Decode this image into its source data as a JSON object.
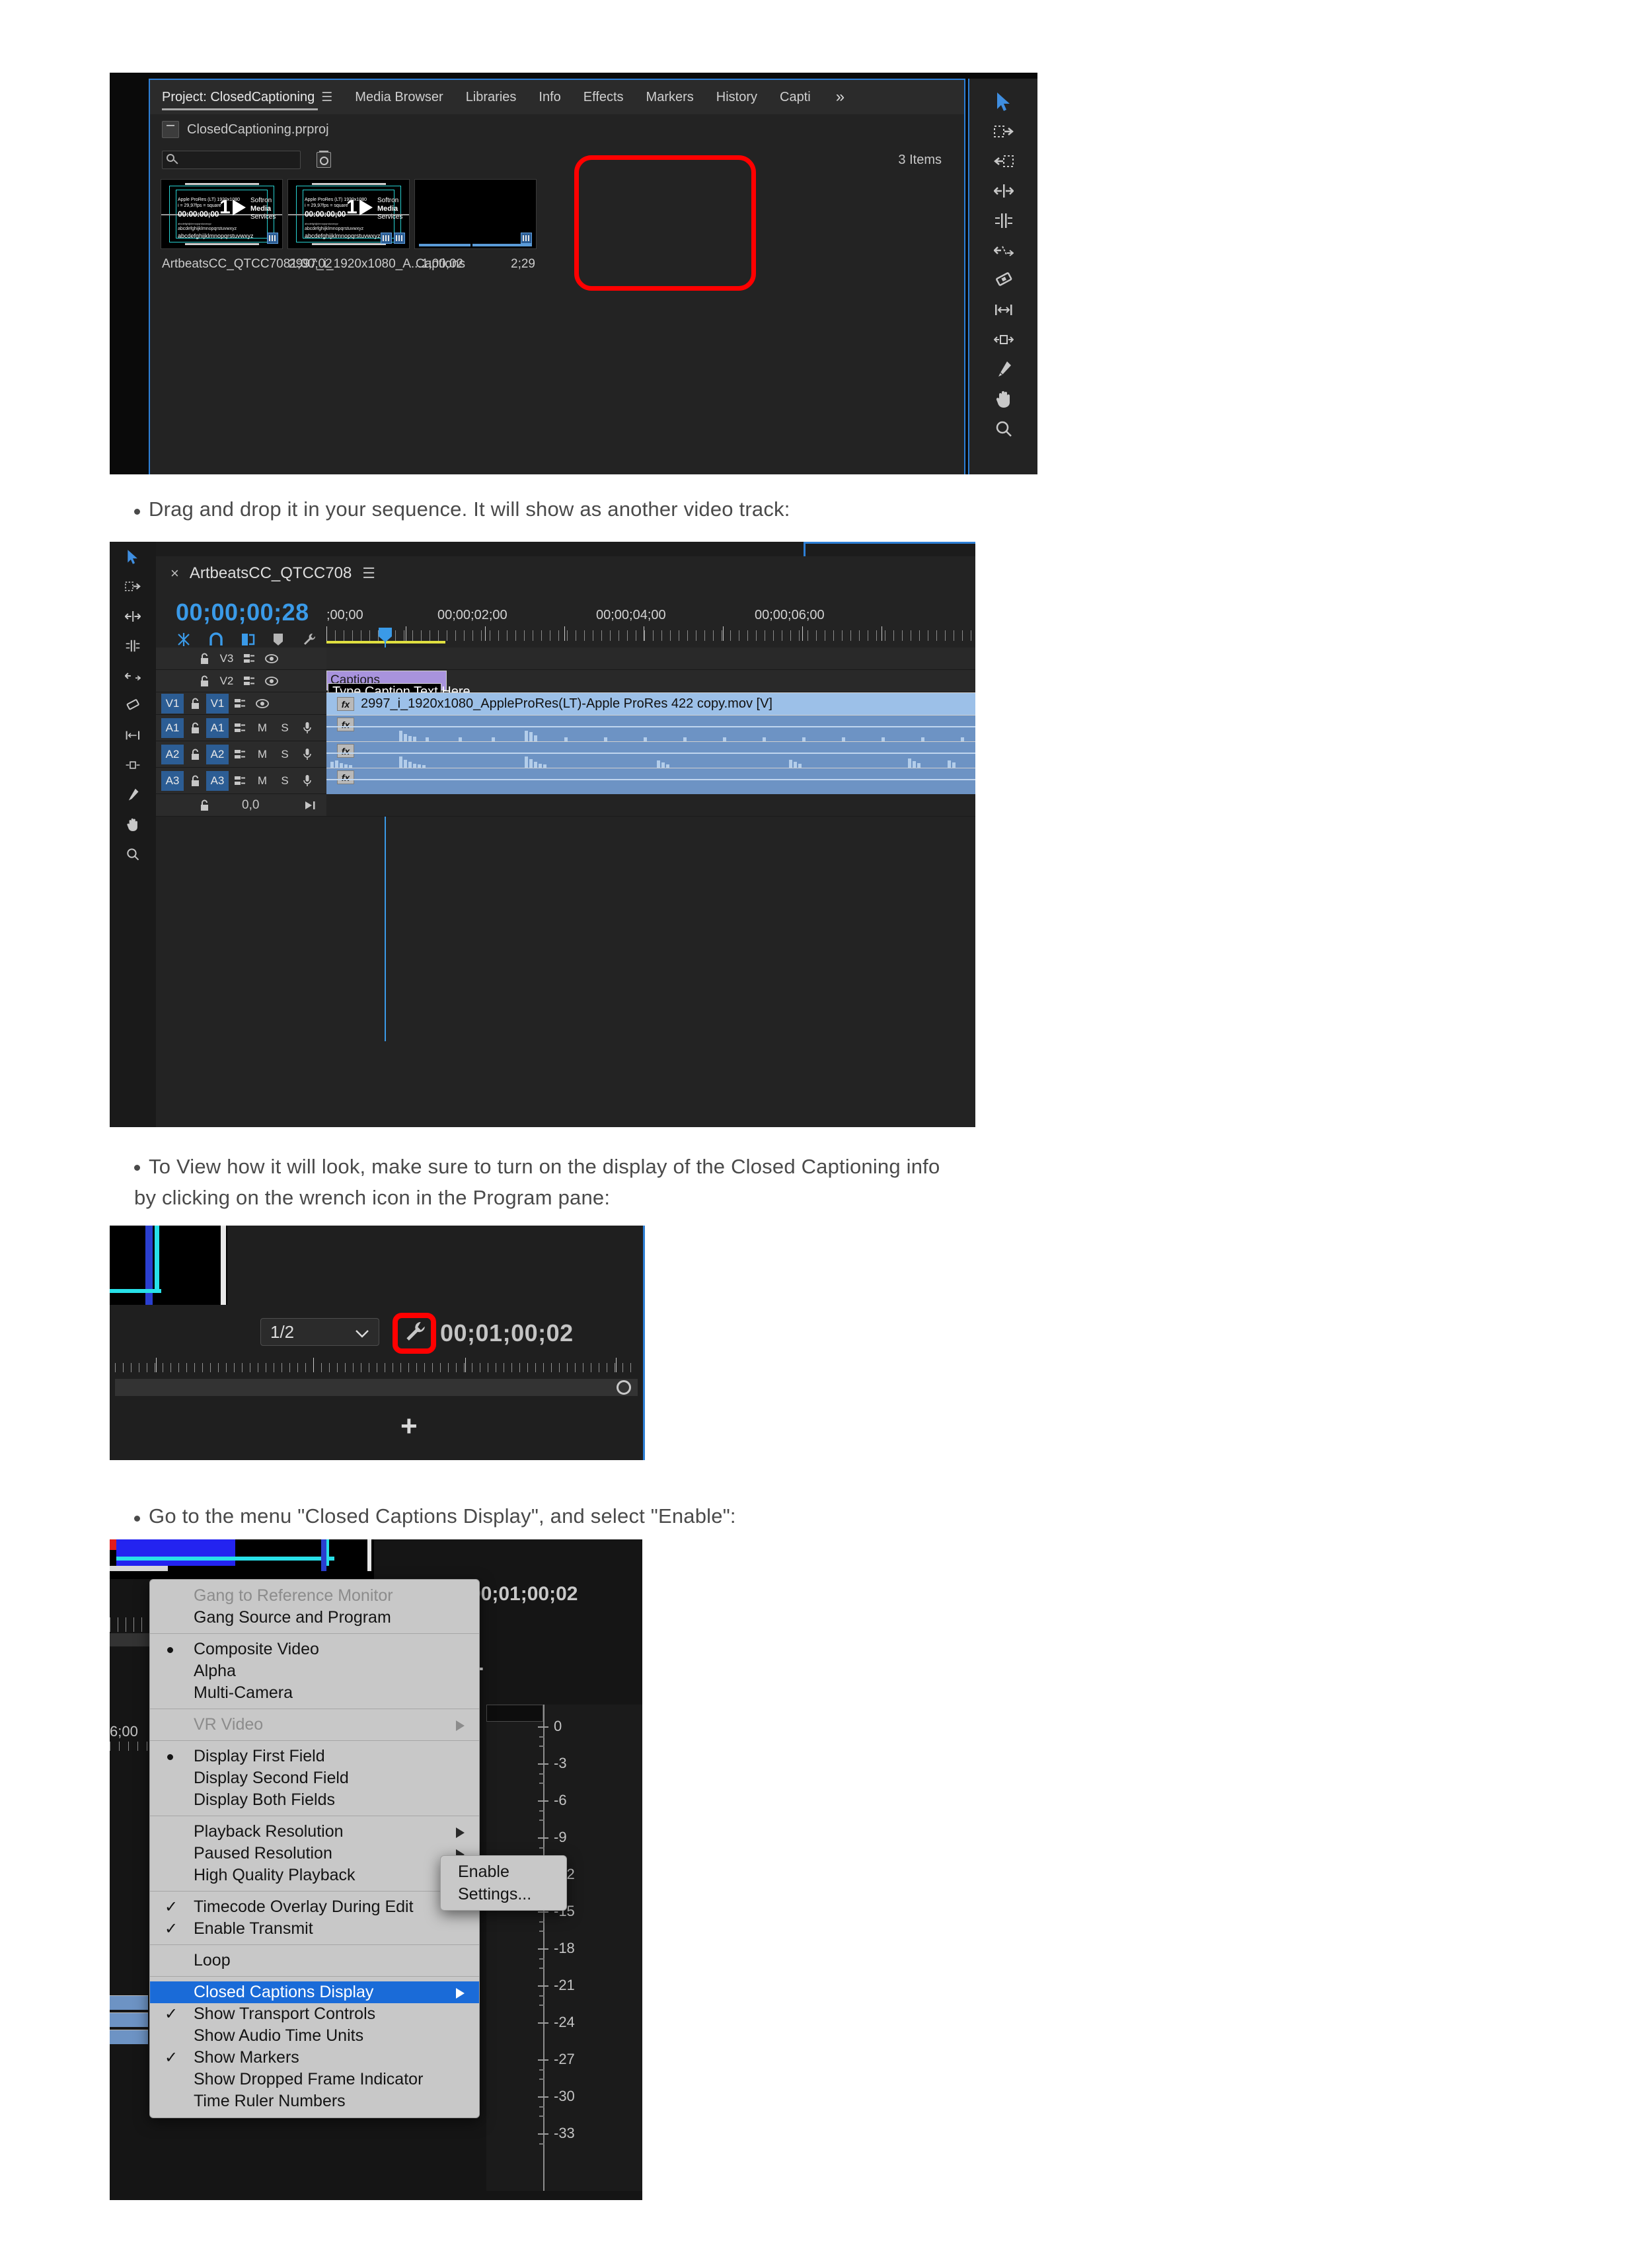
{
  "doc": {
    "bullet1": "Drag and drop it in your sequence. It will show as another video track:",
    "bullet2_line1": "To View how it will look, make sure to turn on the display of the Closed Captioning info",
    "bullet2_line2": "by clicking on the wrench icon in the Program pane:",
    "bullet3": "Go to the menu \"Closed Captions Display\", and select \"Enable\":"
  },
  "project_panel": {
    "tabs": [
      {
        "label": "Project: ClosedCaptioning",
        "active": true,
        "menu": "☰"
      },
      {
        "label": "Media Browser",
        "active": false
      },
      {
        "label": "Libraries",
        "active": false
      },
      {
        "label": "Info",
        "active": false
      },
      {
        "label": "Effects",
        "active": false
      },
      {
        "label": "Markers",
        "active": false
      },
      {
        "label": "History",
        "active": false
      },
      {
        "label": "Capti",
        "active": false
      }
    ],
    "more_chevron": "»",
    "project_file": "ClosedCaptioning.prproj",
    "search_placeholder": "",
    "item_count": "3 Items",
    "items": [
      {
        "name": "ArtbeatsCC_QTCC708",
        "duration": "1;00;02",
        "overlay_line1": "Apple ProRes (LT) 1920x1080",
        "overlay_line2": "i = 29,97fps = square",
        "overlay_timecode": "00:00:00;00",
        "overlay_number": "1",
        "overlay_brand_line1": "Softron",
        "overlay_brand_line2": "Media",
        "overlay_brand_line3": "Services",
        "overlay_alpha1": "abcdefghijklmnopqrstuvwxyz",
        "overlay_alpha2": "abcdefghijklmnopqrstuvwxyz",
        "overlay_alpha3": "abcdefghijklmnopqrstuvwxyz",
        "selected": false
      },
      {
        "name": "2997_i_1920x1080_A...",
        "duration": "1;00;02",
        "overlay_line1": "Apple ProRes (LT) 1920x1080",
        "overlay_line2": "i = 29,97fps = square",
        "overlay_timecode": "00:00:00;00",
        "overlay_number": "1",
        "overlay_brand_line1": "Softron",
        "overlay_brand_line2": "Media",
        "overlay_brand_line3": "Services",
        "overlay_alpha1": "abcdefghijklmnopqrstuvwxyz",
        "overlay_alpha2": "abcdefghijklmnopqrstuvwxyz",
        "overlay_alpha3": "abcdefghijklmnopqrstuvwxyz",
        "selected": false
      },
      {
        "name": "Captions",
        "duration": "2;29",
        "overlay_line1": "",
        "overlay_line2": "",
        "overlay_timecode": "",
        "overlay_number": "",
        "overlay_brand_line1": "",
        "overlay_brand_line2": "",
        "overlay_brand_line3": "",
        "overlay_alpha1": "",
        "overlay_alpha2": "",
        "overlay_alpha3": "",
        "selected": true
      }
    ],
    "tools": [
      "selection-tool",
      "track-select-forward-tool",
      "track-select-backward-tool",
      "ripple-edit-tool",
      "rolling-edit-tool",
      "rate-stretch-tool",
      "razor-tool",
      "slip-tool",
      "slide-tool",
      "pen-tool",
      "hand-tool",
      "zoom-tool"
    ],
    "highlight_color": "#ff0000"
  },
  "timeline": {
    "close_glyph": "×",
    "sequence_name": "ArtbeatsCC_QTCC708",
    "menu_glyph": "☰",
    "playhead_timecode": "00;00;00;28",
    "timecode_color": "#3a9ae8",
    "ruler_labels": [
      ";00;00",
      "00;00;02;00",
      "00;00;04;00",
      "00;00;06;00"
    ],
    "tracks": [
      {
        "id": "V3",
        "type": "video",
        "targeted": false
      },
      {
        "id": "V2",
        "type": "video",
        "targeted": false
      },
      {
        "id": "V1",
        "type": "video",
        "targeted": true
      },
      {
        "id": "A1",
        "type": "audio",
        "targeted": true,
        "mute": "M",
        "solo": "S"
      },
      {
        "id": "A2",
        "type": "audio",
        "targeted": true,
        "mute": "M",
        "solo": "S"
      },
      {
        "id": "A3",
        "type": "audio",
        "targeted": true,
        "mute": "M",
        "solo": "S"
      }
    ],
    "caption_clip_label": "Captions",
    "caption_text_label": "Type Caption Text Here",
    "video_clip_label": "2997_i_1920x1080_AppleProRes(LT)-Apple ProRes 422 copy.mov [V]",
    "fx_badge": "fx",
    "footer_value": "0,0",
    "caption_clip_color": "#a893dd",
    "video_clip_color": "#9cc0e8",
    "audio_clip_color": "#6d93c4"
  },
  "program_monitor": {
    "resolution_value": "1/2",
    "resolution_chevron": "⌄",
    "timecode": "00;01;00;02",
    "settings_icon": "wrench-icon",
    "highlight_color": "#ff0000",
    "add_button": "+"
  },
  "settings_menu": {
    "timecode": "00;01;00;02",
    "left_timecode": "6;00",
    "items": [
      {
        "label": "Gang to Reference Monitor",
        "state": "disabled",
        "mark": "",
        "submenu": false
      },
      {
        "label": "Gang Source and Program",
        "state": "normal",
        "mark": "",
        "submenu": false
      },
      {
        "separator": true
      },
      {
        "label": "Composite Video",
        "state": "normal",
        "mark": "bullet",
        "submenu": false
      },
      {
        "label": "Alpha",
        "state": "normal",
        "mark": "",
        "submenu": false
      },
      {
        "label": "Multi-Camera",
        "state": "normal",
        "mark": "",
        "submenu": false
      },
      {
        "separator": true
      },
      {
        "label": "VR Video",
        "state": "disabled",
        "mark": "",
        "submenu": true
      },
      {
        "separator": true
      },
      {
        "label": "Display First Field",
        "state": "normal",
        "mark": "bullet",
        "submenu": false
      },
      {
        "label": "Display Second Field",
        "state": "normal",
        "mark": "",
        "submenu": false
      },
      {
        "label": "Display Both Fields",
        "state": "normal",
        "mark": "",
        "submenu": false
      },
      {
        "separator": true
      },
      {
        "label": "Playback Resolution",
        "state": "normal",
        "mark": "",
        "submenu": true
      },
      {
        "label": "Paused Resolution",
        "state": "normal",
        "mark": "",
        "submenu": true
      },
      {
        "label": "High Quality Playback",
        "state": "normal",
        "mark": "",
        "submenu": false
      },
      {
        "separator": true
      },
      {
        "label": "Timecode Overlay During Edit",
        "state": "normal",
        "mark": "check",
        "submenu": false
      },
      {
        "label": "Enable Transmit",
        "state": "normal",
        "mark": "check",
        "submenu": false
      },
      {
        "separator": true
      },
      {
        "label": "Loop",
        "state": "normal",
        "mark": "",
        "submenu": false
      },
      {
        "separator": true
      },
      {
        "label": "Closed Captions Display",
        "state": "selected",
        "mark": "",
        "submenu": true
      },
      {
        "label": "Show Transport Controls",
        "state": "normal",
        "mark": "check",
        "submenu": false
      },
      {
        "label": "Show Audio Time Units",
        "state": "normal",
        "mark": "",
        "submenu": false
      },
      {
        "label": "Show Markers",
        "state": "normal",
        "mark": "check",
        "submenu": false
      },
      {
        "label": "Show Dropped Frame Indicator",
        "state": "normal",
        "mark": "",
        "submenu": false
      },
      {
        "label": "Time Ruler Numbers",
        "state": "normal",
        "mark": "",
        "submenu": false
      }
    ],
    "submenu_items": [
      "Enable",
      "Settings..."
    ],
    "check_glyph": "✓",
    "highlight_color": "#1a6bd8",
    "audio_meter_labels": [
      "0",
      "-3",
      "-6",
      "-9",
      "-12",
      "-15",
      "-18",
      "-21",
      "-24",
      "-27",
      "-30",
      "-33"
    ]
  }
}
